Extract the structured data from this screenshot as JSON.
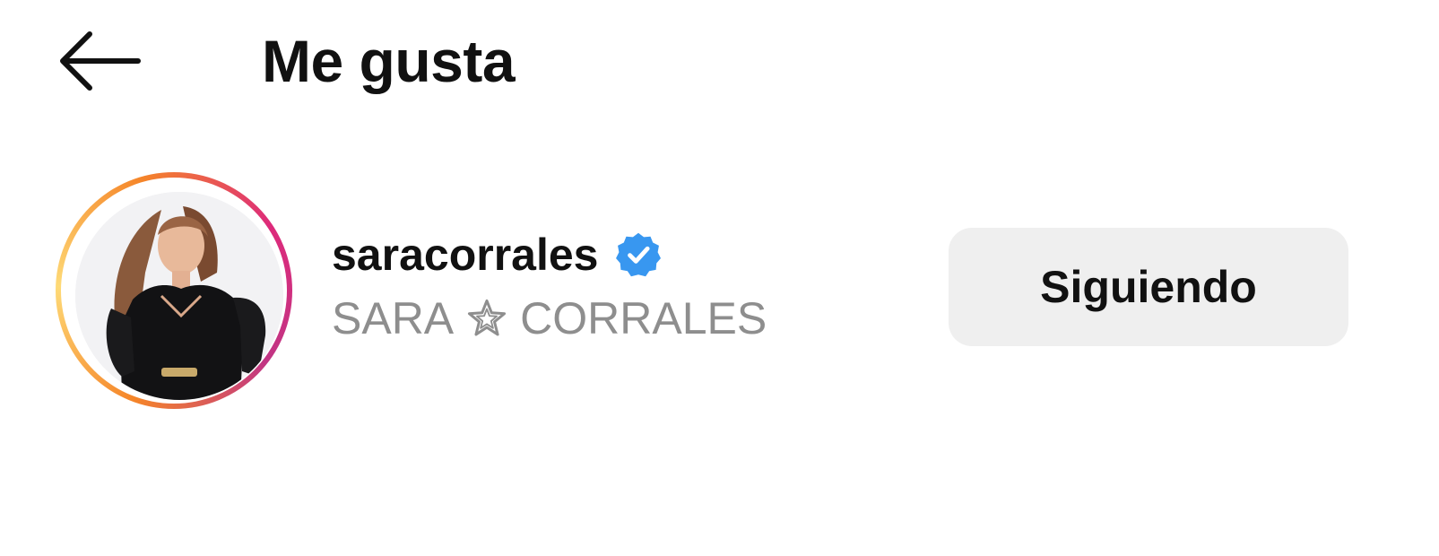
{
  "header": {
    "back_icon": "arrow-left-icon",
    "title": "Me gusta"
  },
  "likes": [
    {
      "username": "saracorrales",
      "verified": true,
      "verified_icon": "verified-badge-icon",
      "verified_color": "#3897f0",
      "full_name_part1": "SARA",
      "separator_icon": "star-icon",
      "full_name_part2": "CORRALES",
      "has_story_ring": true,
      "follow_label": "Siguiendo"
    }
  ],
  "colors": {
    "background": "#ffffff",
    "text_primary": "#111111",
    "text_secondary": "#8e8e8e",
    "button_background": "#efefef",
    "story_ring_start": "#f58529",
    "story_ring_end": "#c13584"
  }
}
